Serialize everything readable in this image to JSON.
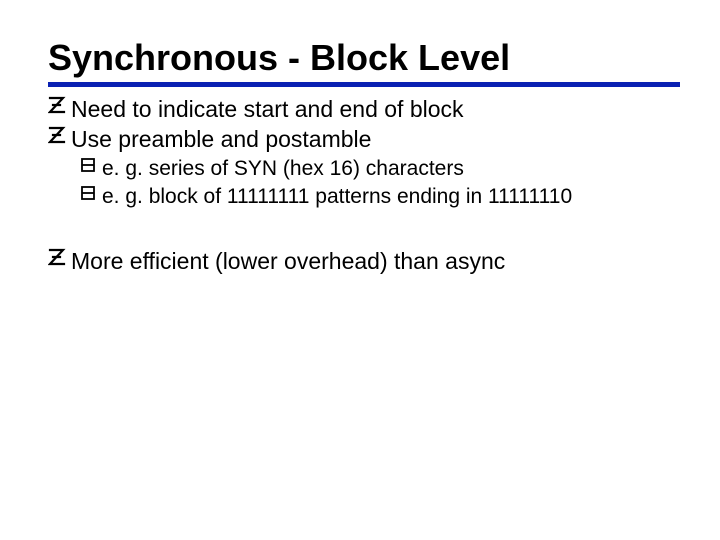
{
  "title": "Synchronous - Block Level",
  "bullets": {
    "b1": "Need to indicate start and end of block",
    "b2": "Use preamble and postamble",
    "b2a": "e. g. series of SYN (hex 16) characters",
    "b2b": "e. g. block of 11111111 patterns ending in 11111110",
    "b3": "More efficient (lower overhead) than async"
  }
}
